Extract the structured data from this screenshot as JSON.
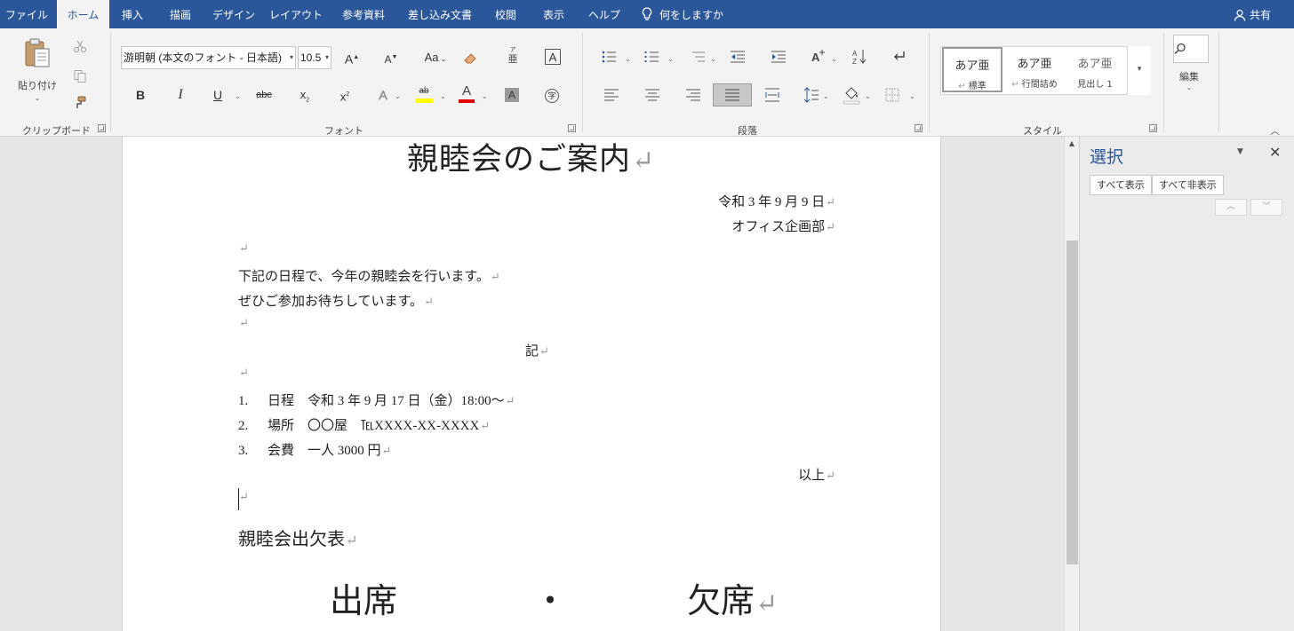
{
  "tabs": [
    {
      "label": "ファイル",
      "active": false
    },
    {
      "label": "ホーム",
      "active": true
    },
    {
      "label": "挿入",
      "active": false
    },
    {
      "label": "描画",
      "active": false
    },
    {
      "label": "デザイン",
      "active": false
    },
    {
      "label": "レイアウト",
      "active": false
    },
    {
      "label": "参考資料",
      "active": false
    },
    {
      "label": "差し込み文書",
      "active": false
    },
    {
      "label": "校閲",
      "active": false
    },
    {
      "label": "表示",
      "active": false
    },
    {
      "label": "ヘルプ",
      "active": false
    }
  ],
  "tellme": {
    "label": "何をしますか",
    "icon": "lightbulb-icon"
  },
  "share": {
    "label": "共有",
    "icon": "person-icon"
  },
  "ribbon": {
    "clipboard": {
      "group_label": "クリップボード",
      "paste_label": "貼り付け"
    },
    "font": {
      "group_label": "フォント",
      "font_name": "游明朝 (本文のフォント - 日本語)",
      "font_size": "10.5",
      "grow": "A",
      "shrink": "A",
      "case": "Aa",
      "ruby_top": "ア",
      "ruby_bottom": "亜",
      "border_char": "A",
      "bold": "B",
      "italic": "I",
      "underline": "U",
      "strike": "abc",
      "subscript": "x",
      "superscript": "x",
      "effects": "A",
      "highlight": "ab",
      "font_color": "A",
      "shading": "A",
      "enclose": "字",
      "highlight_color": "#ffff00",
      "font_color_value": "#e00000"
    },
    "paragraph": {
      "group_label": "段落"
    },
    "styles": {
      "group_label": "スタイル",
      "items": [
        {
          "preview": "あア亜",
          "name": "標準",
          "selected": true
        },
        {
          "preview": "あア亜",
          "name": "行間詰め",
          "selected": false
        },
        {
          "preview": "あア亜",
          "name": "見出し 1",
          "selected": false
        }
      ]
    },
    "editing": {
      "label": "編集"
    }
  },
  "document": {
    "title": "親睦会のご案内",
    "date": "令和 3 年 9 月 9 日",
    "org": "オフィス企画部",
    "body": [
      "下記の日程で、今年の親睦会を行います。",
      "ぜひご参加お待ちしています。"
    ],
    "ki": "記",
    "items": [
      {
        "num": "1.",
        "text": "日程　令和 3 年 9 月 17 日（金）18:00～"
      },
      {
        "num": "2.",
        "text": "場所　〇〇屋　℡XXXX-XX-XXXX"
      },
      {
        "num": "3.",
        "text": "会費　一人 3000 円"
      }
    ],
    "ijou": "以上",
    "table_title": "親睦会出欠表",
    "attend": {
      "present": "出席",
      "dot": "・",
      "absent": "欠席"
    }
  },
  "selection_pane": {
    "title": "選択",
    "show_all": "すべて表示",
    "hide_all": "すべて非表示"
  }
}
